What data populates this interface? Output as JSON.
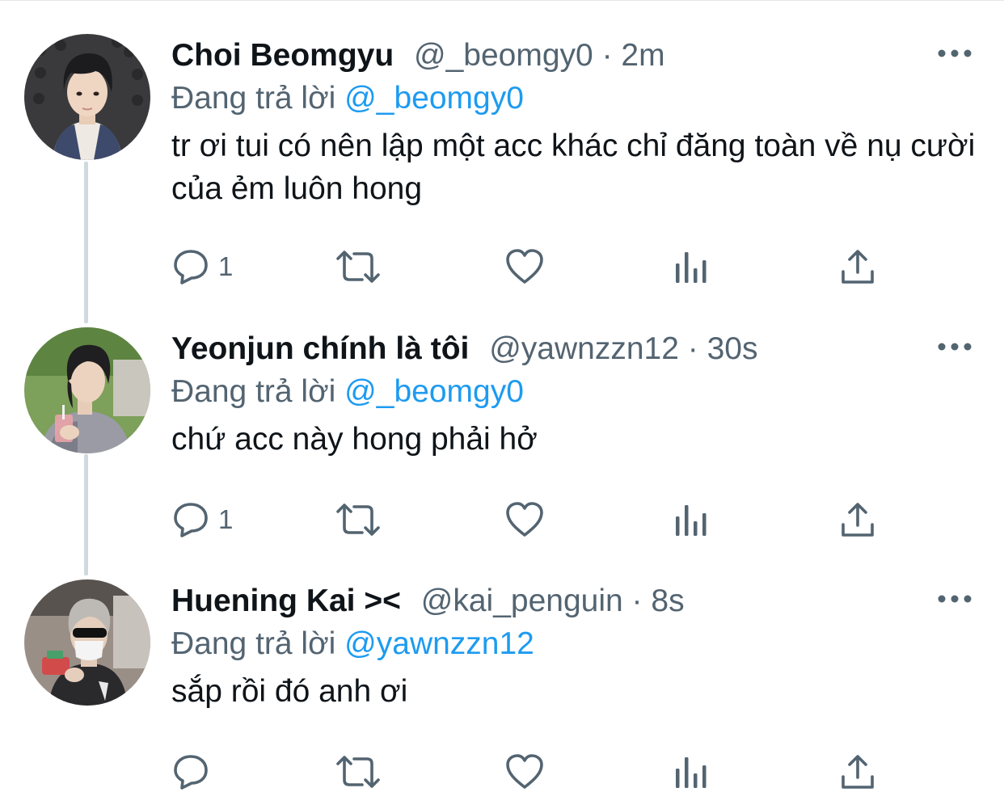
{
  "colors": {
    "name": "#0f1419",
    "secondary": "#536471",
    "mention": "#1d9bf0",
    "thread_line": "#cfd9de"
  },
  "tweets": [
    {
      "name": "Choi Beomgyu",
      "handle": "@_beomgy0",
      "separator": "·",
      "time": "2m",
      "reply_prefix": "Đang trả lời",
      "reply_to": "@_beomgy0",
      "text": "tr ơi tui có nên lập một acc khác chỉ đăng toàn về nụ cười của ẻm luôn hong",
      "reply_count": "1",
      "icons": [
        "reply-icon",
        "retweet-icon",
        "like-icon",
        "analytics-icon",
        "share-icon",
        "more-icon"
      ]
    },
    {
      "name": "Yeonjun chính là tôi",
      "handle": "@yawnzzn12",
      "separator": "·",
      "time": "30s",
      "reply_prefix": "Đang trả lời",
      "reply_to": "@_beomgy0",
      "text": "chứ acc này hong phải hở",
      "reply_count": "1",
      "icons": [
        "reply-icon",
        "retweet-icon",
        "like-icon",
        "analytics-icon",
        "share-icon",
        "more-icon"
      ]
    },
    {
      "name": "Huening Kai ><",
      "handle": "@kai_penguin",
      "separator": "·",
      "time": "8s",
      "reply_prefix": "Đang trả lời",
      "reply_to": "@yawnzzn12",
      "text": "sắp rồi đó anh ơi",
      "reply_count": "",
      "icons": [
        "reply-icon",
        "retweet-icon",
        "like-icon",
        "analytics-icon",
        "share-icon",
        "more-icon"
      ]
    }
  ]
}
